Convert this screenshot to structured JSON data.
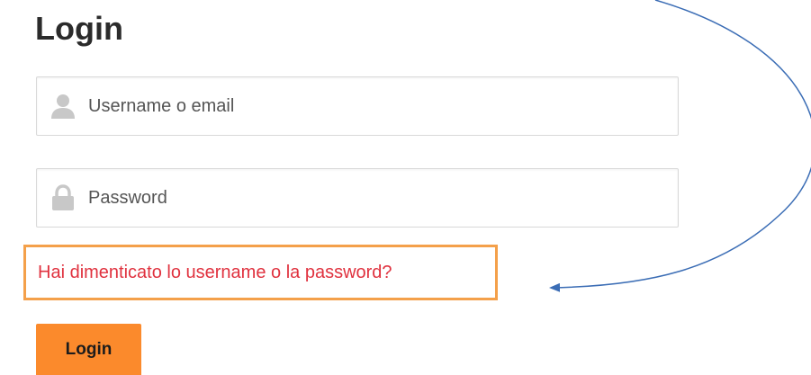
{
  "page": {
    "title": "Login"
  },
  "form": {
    "username": {
      "placeholder": "Username o email",
      "value": "",
      "icon": "user-icon"
    },
    "password": {
      "placeholder": "Password",
      "value": "",
      "icon": "lock-icon"
    },
    "forgot_link": "Hai dimenticato lo username o la password?",
    "submit_label": "Login"
  },
  "annotation": {
    "highlight_color": "#f4a04a",
    "arrow_color": "#3b6db5"
  },
  "colors": {
    "accent": "#fb8a2c",
    "link": "#e0323f",
    "title": "#2b2b2b",
    "icon": "#c8c8c8"
  }
}
